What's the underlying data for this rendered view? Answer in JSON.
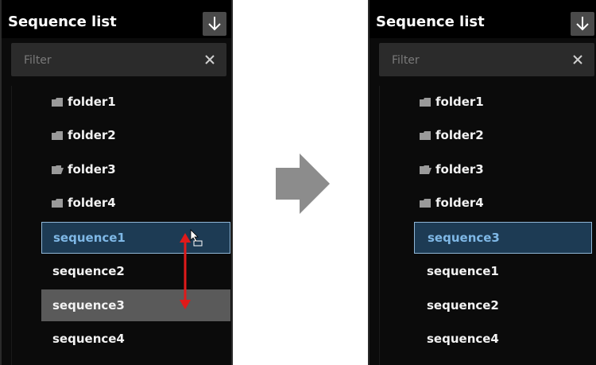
{
  "left_panel": {
    "title": "Sequence list",
    "filter_placeholder": "Filter",
    "clear_symbol": "×",
    "folders": [
      "folder1",
      "folder2",
      "folder3",
      "folder4"
    ],
    "sequences": [
      "sequence1",
      "sequence2",
      "sequence3",
      "sequence4"
    ]
  },
  "right_panel": {
    "title": "Sequence list",
    "filter_placeholder": "Filter",
    "clear_symbol": "×",
    "folders": [
      "folder1",
      "folder2",
      "folder3",
      "folder4"
    ],
    "sequences": [
      "sequence3",
      "sequence1",
      "sequence2",
      "sequence4"
    ]
  },
  "icons": {
    "download": "download-arrow-icon",
    "folder": "folder-icon",
    "open_folder": "folder-open-icon",
    "cursor": "drag-hand-cursor-icon",
    "drag_direction": "double-headed-arrow-icon",
    "transition": "right-arrow-icon"
  },
  "colors": {
    "panel_bg": "#0b0b0b",
    "header_bg": "#000000",
    "filter_bg": "#2b2b2b",
    "selected_bg": "#1d3b54",
    "selected_border": "#8fb6d6",
    "selected_text": "#7fb8e6",
    "drop_target_bg": "#5a5a5a",
    "drag_arrow": "#e01a1a",
    "transition_arrow": "#8c8c8c"
  }
}
